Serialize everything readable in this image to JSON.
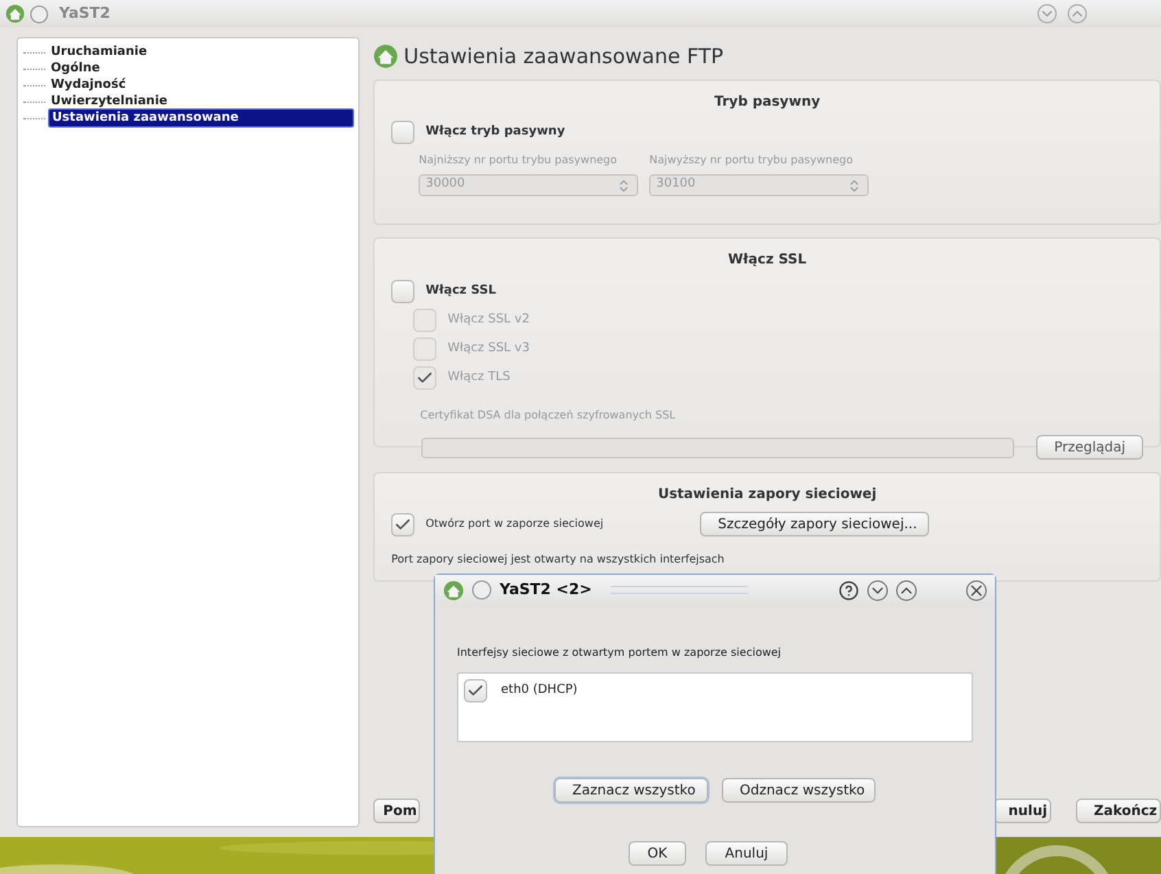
{
  "window": {
    "title": "YaST2"
  },
  "tree": {
    "items": [
      {
        "label": "Uruchamianie",
        "selected": false
      },
      {
        "label": "Ogólne",
        "selected": false
      },
      {
        "label": "Wydajność",
        "selected": false
      },
      {
        "label": "Uwierzytelnianie",
        "selected": false
      },
      {
        "label": "Ustawienia zaawansowane",
        "selected": true
      }
    ]
  },
  "heading": "Ustawienia zaawansowane FTP",
  "passive": {
    "title": "Tryb pasywny",
    "enable": {
      "label": "Włącz tryb pasywny",
      "checked": false
    },
    "fields": [
      {
        "label": "Najniższy nr portu trybu pasywnego",
        "value": "30000",
        "disabled": true
      },
      {
        "label": "Najwyższy nr portu trybu pasywnego",
        "value": "30100",
        "disabled": true
      }
    ]
  },
  "ssl": {
    "title": "Włącz SSL",
    "enable": {
      "label": "Włącz SSL",
      "checked": false
    },
    "options": [
      {
        "label": "Włącz SSL v2",
        "checked": false,
        "disabled": true
      },
      {
        "label": "Włącz SSL v3",
        "checked": false,
        "disabled": true
      },
      {
        "label": "Włącz TLS",
        "checked": true,
        "disabled": true
      }
    ],
    "cert_label": "Certyfikat DSA dla połączeń szyfrowanych SSL",
    "browse_button": "Przeglądaj"
  },
  "firewall": {
    "title": "Ustawienia zapory sieciowej",
    "open_port": {
      "label": "Otwórz port w zaporze sieciowej",
      "checked": true
    },
    "details_button": "Szczegóły zapory sieciowej...",
    "status": "Port zapory sieciowej jest otwarty na wszystkich interfejsach"
  },
  "buttons": [
    "Pom",
    "nuluj",
    "Zakończ"
  ],
  "dialog": {
    "title": "YaST2 <2>",
    "list_label": "Interfejsy sieciowe z otwartym portem w zaporze sieciowej",
    "interfaces": [
      {
        "label": "eth0 (DHCP)",
        "checked": true
      }
    ],
    "buttons": [
      {
        "label": "Zaznacz wszystko",
        "focused": true
      },
      {
        "label": "Odznacz wszystko",
        "focused": false
      }
    ],
    "footer_buttons": [
      "OK",
      "Anuluj"
    ]
  }
}
